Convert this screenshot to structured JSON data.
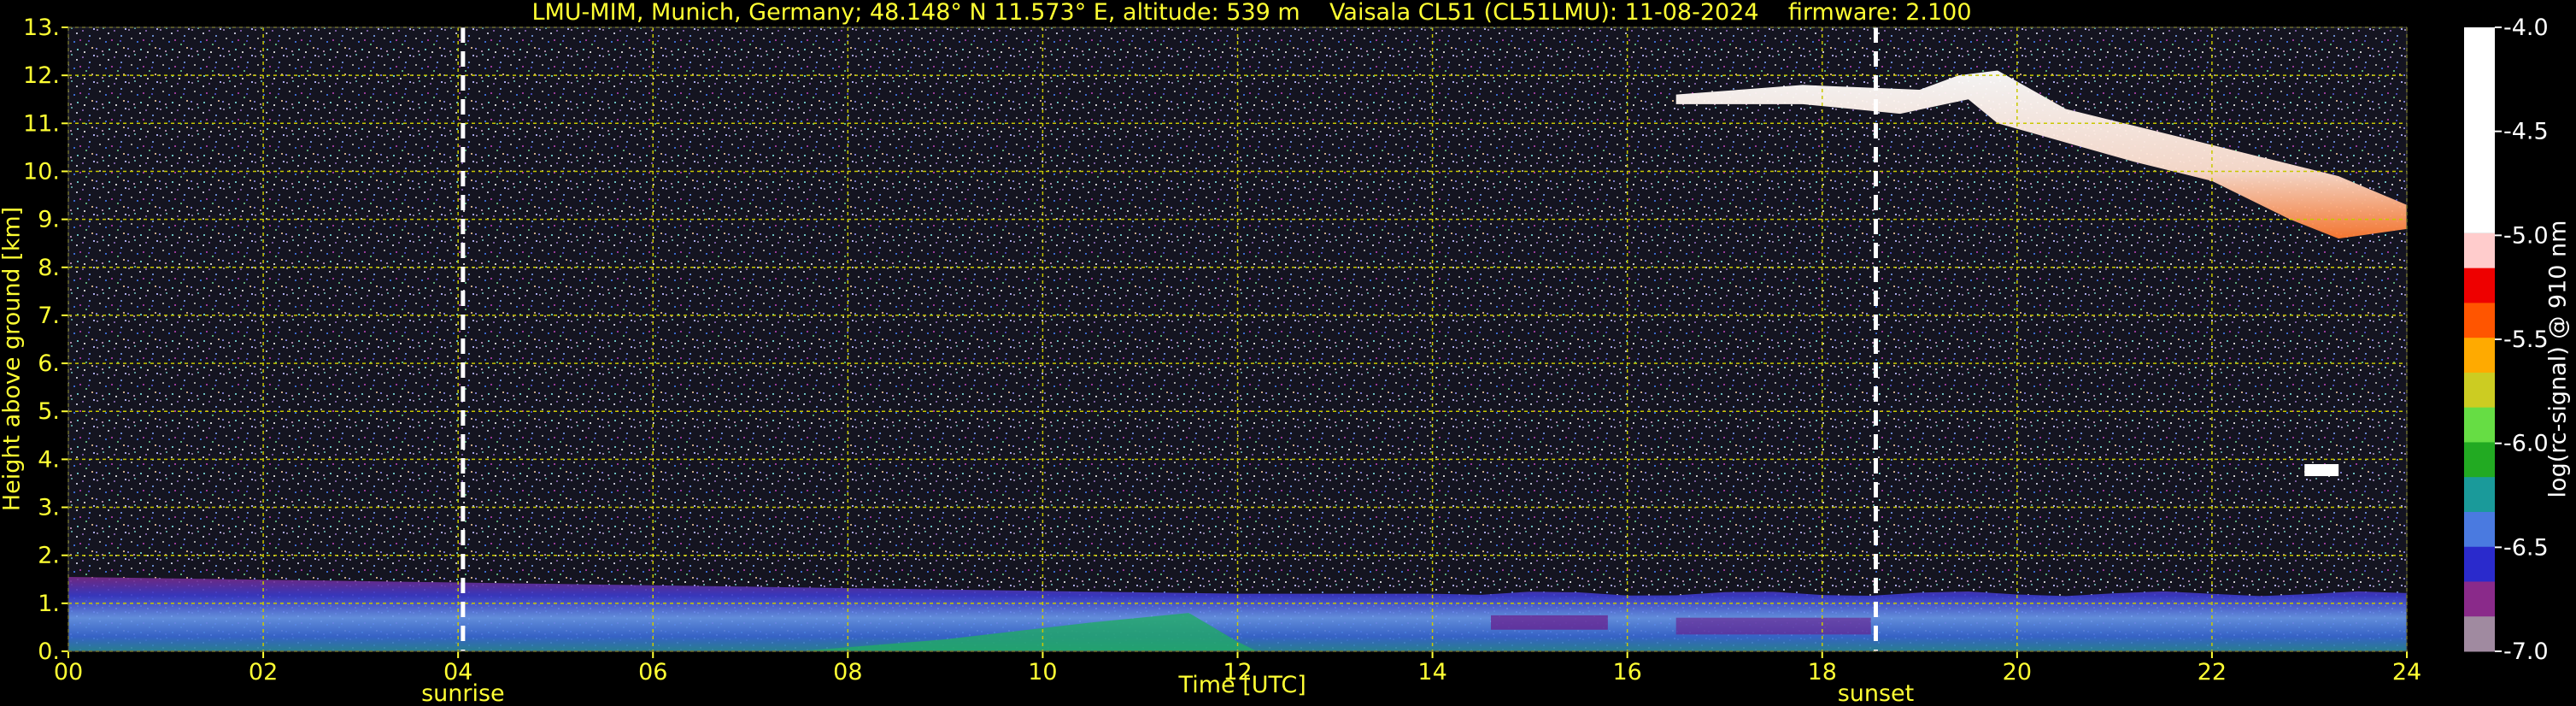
{
  "title": "LMU-MIM, Munich, Germany; 48.148° N 11.573° E, altitude: 539 m    Vaisala CL51 (CL51LMU): 11-08-2024    firmware: 2.100",
  "chart_data": {
    "type": "heatmap",
    "title": "LMU-MIM, Munich, Germany; 48.148° N 11.573° E, altitude: 539 m    Vaisala CL51 (CL51LMU): 11-08-2024    firmware: 2.100",
    "xlabel": "Time [UTC]",
    "ylabel": "Height above ground [km]",
    "xlim": [
      0,
      24
    ],
    "ylim": [
      0,
      13
    ],
    "xticks": [
      "00",
      "02",
      "04",
      "06",
      "08",
      "10",
      "12",
      "14",
      "16",
      "18",
      "20",
      "22",
      "24"
    ],
    "yticks": [
      "0.",
      "1.",
      "2.",
      "3.",
      "4.",
      "5.",
      "6.",
      "7.",
      "8.",
      "9.",
      "10.",
      "11.",
      "12.",
      "13."
    ],
    "grid": true,
    "colorbar": {
      "label": "log(rc-signal) @ 910 nm",
      "range": [
        -7.0,
        -4.0
      ],
      "ticks": [
        "-4.0",
        "-4.5",
        "-5.0",
        "-5.5",
        "-6.0",
        "-6.5",
        "-7.0"
      ]
    },
    "vertical_lines": [
      {
        "x": 4.05,
        "label": "sunrise"
      },
      {
        "x": 18.55,
        "label": "sunset"
      }
    ],
    "features": [
      {
        "name": "boundary layer aerosol",
        "x_range": [
          0,
          24
        ],
        "height_km": [
          0,
          1.6
        ]
      },
      {
        "name": "high cloud",
        "x_range": [
          16.5,
          24
        ],
        "height_km": [
          8.5,
          12.1
        ]
      }
    ]
  },
  "colors": {
    "axis_text": "#ffff33",
    "grid": "#c8c800",
    "background": "#000000",
    "colorbar_scale": [
      "#a08aa0",
      "#8a2a8a",
      "#2a2acc",
      "#4a7ae0",
      "#1a9a9a",
      "#22aa22",
      "#66dd44",
      "#cccc22",
      "#ffaa00",
      "#ff5500",
      "#ee0000",
      "#ffcccc",
      "#ffffff"
    ]
  }
}
